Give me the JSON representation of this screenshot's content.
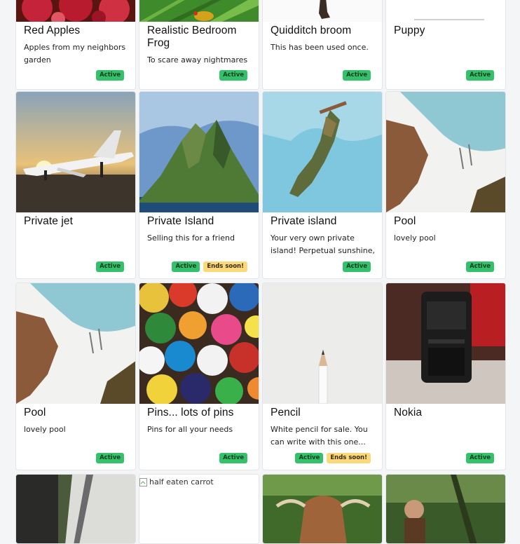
{
  "cards": [
    {
      "title": "Red Apples",
      "description": "Apples from my neighbors garden",
      "badges": [
        "Active"
      ]
    },
    {
      "title": "Realistic Bedroom Frog",
      "description": "To scare away nightmares",
      "badges": [
        "Active"
      ]
    },
    {
      "title": "Quidditch broom",
      "description": "This has been used once.",
      "badges": [
        "Active"
      ]
    },
    {
      "title": "Puppy",
      "description": "",
      "badges": [
        "Active"
      ]
    },
    {
      "title": "Private jet",
      "description": "",
      "badges": [
        "Active"
      ]
    },
    {
      "title": "Private Island",
      "description": "Selling this for a friend",
      "badges": [
        "Active",
        "Ends soon!"
      ]
    },
    {
      "title": "Private island",
      "description": "Your very own private island! Perpetual sunshine, ...",
      "badges": [
        "Active"
      ]
    },
    {
      "title": "Pool",
      "description": "lovely pool",
      "badges": [
        "Active"
      ]
    },
    {
      "title": "Pool",
      "description": "lovely pool",
      "badges": [
        "Active"
      ]
    },
    {
      "title": "Pins... lots of pins",
      "description": "Pins for all your needs",
      "badges": [
        "Active"
      ]
    },
    {
      "title": "Pencil",
      "description": "White pencil for sale. You can write with this one...",
      "badges": [
        "Active",
        "Ends soon!"
      ]
    },
    {
      "title": "Nokia",
      "description": "",
      "badges": [
        "Active"
      ]
    }
  ],
  "bottom_row": {
    "broken_image_alt": "half eaten carrot"
  },
  "colors": {
    "active": "#34c16b",
    "ends_soon": "#fbd97a",
    "background": "#f4f5f6"
  }
}
